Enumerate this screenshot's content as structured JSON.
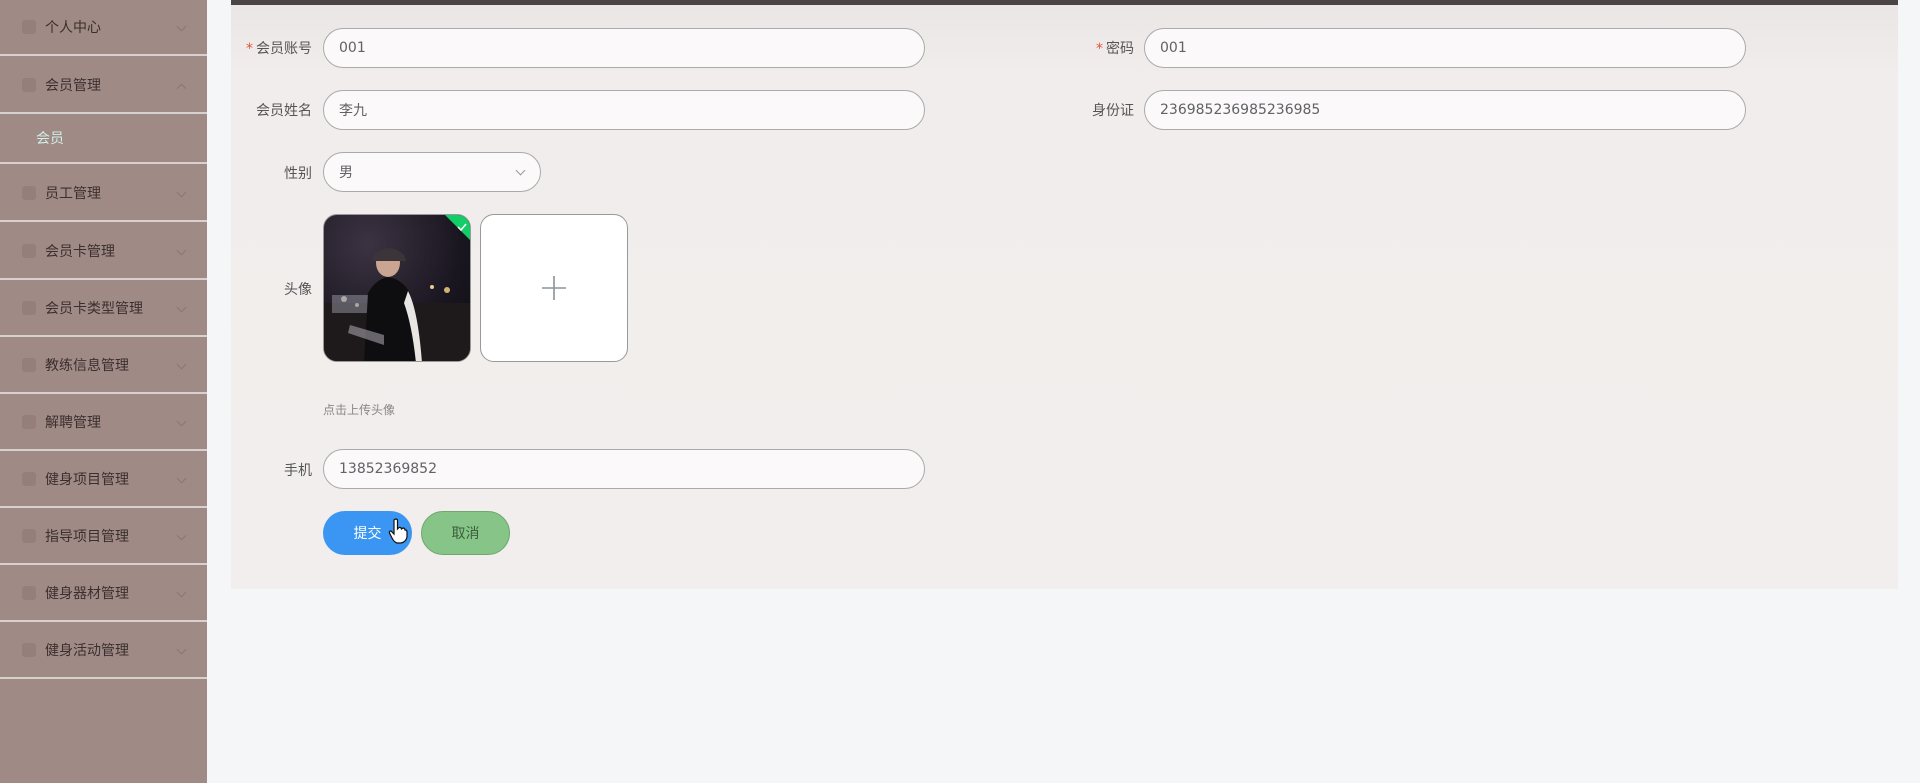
{
  "sidebar": {
    "items": [
      {
        "label": "个人中心",
        "icon": "user-icon"
      },
      {
        "label": "会员管理",
        "icon": "flag-icon"
      },
      {
        "label": "员工管理",
        "icon": "list-icon"
      },
      {
        "label": "会员卡管理",
        "icon": "card-icon"
      },
      {
        "label": "会员卡类型管理",
        "icon": "cardtype-icon"
      },
      {
        "label": "教练信息管理",
        "icon": "coach-icon"
      },
      {
        "label": "解聘管理",
        "icon": "dismiss-icon"
      },
      {
        "label": "健身项目管理",
        "icon": "project-icon"
      },
      {
        "label": "指导项目管理",
        "icon": "guide-icon"
      },
      {
        "label": "健身器材管理",
        "icon": "equipment-icon"
      },
      {
        "label": "健身活动管理",
        "icon": "activity-icon"
      }
    ],
    "submenu": {
      "label": "会员"
    }
  },
  "form": {
    "account": {
      "label": "会员账号",
      "value": "001",
      "required": "*"
    },
    "password": {
      "label": "密码",
      "value": "001",
      "required": "*"
    },
    "name": {
      "label": "会员姓名",
      "value": "李九"
    },
    "idcard": {
      "label": "身份证",
      "value": "236985236985236985"
    },
    "gender": {
      "label": "性别",
      "value": "男"
    },
    "avatar": {
      "label": "头像",
      "hint": "点击上传头像",
      "upload_icon": "plus-icon"
    },
    "phone": {
      "label": "手机",
      "value": "13852369852"
    },
    "submit_label": "提交",
    "cancel_label": "取消"
  },
  "colors": {
    "sidebar_bg": "#a08a86",
    "submenu_text": "#cfeee8",
    "submit_bg": "#3a96f2",
    "cancel_bg": "#86c587",
    "required": "#e0533f",
    "success": "#13ce66"
  }
}
